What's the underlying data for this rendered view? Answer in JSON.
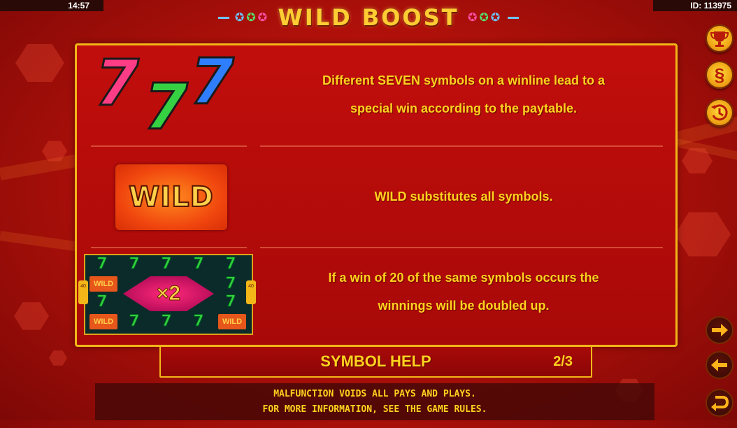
{
  "status_bar": {
    "time": "14:57",
    "id": "ID: 113975"
  },
  "header": {
    "title": "WILD BOOST",
    "star_colors": [
      "#6cc6ff",
      "#57e06a",
      "#ff4fa8"
    ]
  },
  "symbols": [
    {
      "image": "seven-symbols",
      "description_lines": [
        "Different SEVEN symbols on a winline lead to a",
        "special win according to the paytable."
      ]
    },
    {
      "image": "wild-symbol",
      "image_text": "WILD",
      "description_lines": [
        "WILD substitutes all symbols."
      ]
    },
    {
      "image": "multiplier-board",
      "image_text": "×2",
      "side_labels": [
        "40",
        "40"
      ],
      "board_wild_labels": [
        "WILD",
        "WILD",
        "WILD"
      ],
      "description_lines": [
        "If a win of 20 of the same symbols occurs the",
        "winnings will be doubled up."
      ]
    }
  ],
  "footer": {
    "title": "SYMBOL HELP",
    "page": "2/3"
  },
  "disclaimer": {
    "line1": "MALFUNCTION VOIDS ALL PAYS AND PLAYS.",
    "line2": "FOR MORE INFORMATION, SEE THE GAME RULES."
  },
  "side_buttons": {
    "paytable": {
      "icon": "trophy-icon"
    },
    "rules": {
      "icon": "section-icon",
      "glyph": "§"
    },
    "history": {
      "icon": "history-icon"
    },
    "next": {
      "icon": "arrow-right-icon"
    },
    "previous": {
      "icon": "arrow-left-icon"
    },
    "back": {
      "icon": "return-icon"
    }
  },
  "colors": {
    "accent": "#ffd21f",
    "frame": "#f2b619",
    "background": "#b3110a"
  }
}
